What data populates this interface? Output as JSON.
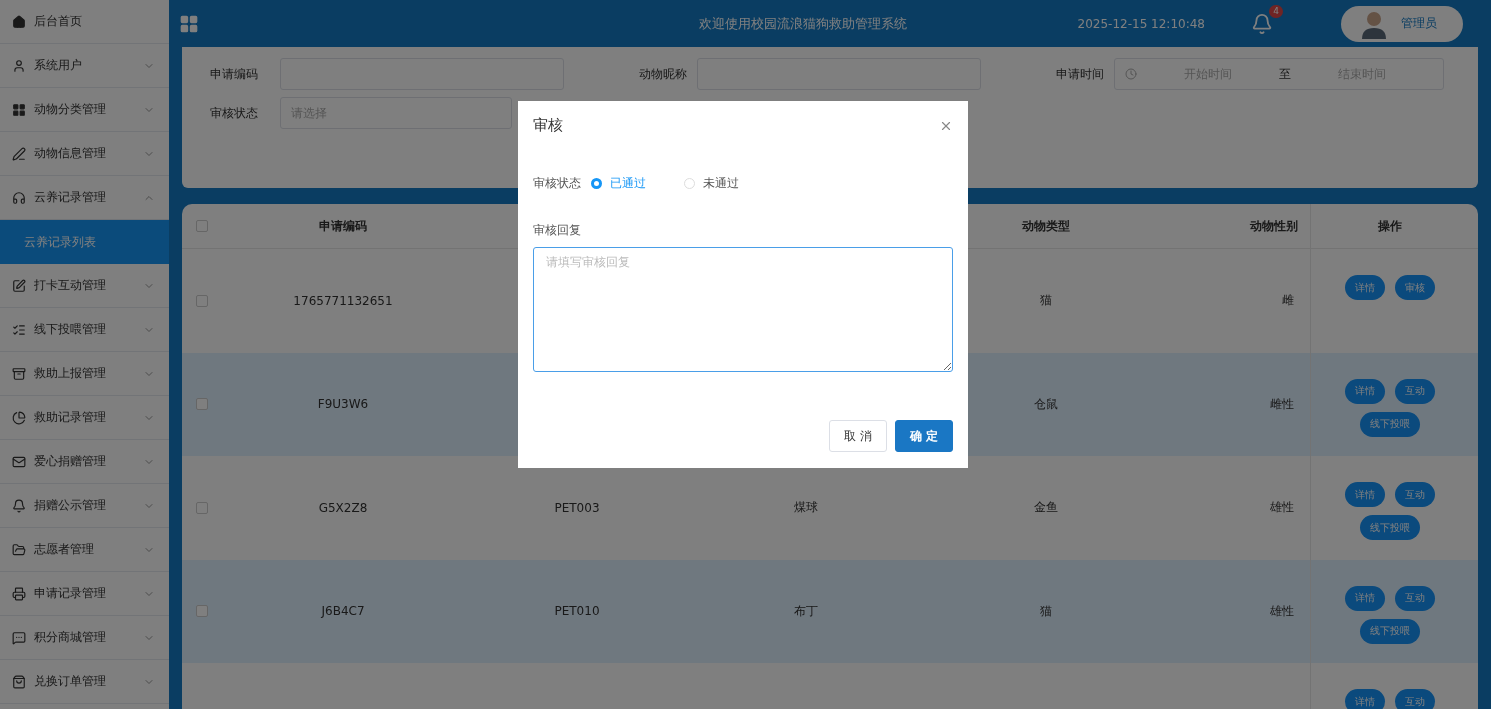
{
  "sidebar": {
    "items": [
      {
        "label": "后台首页",
        "selected": false
      },
      {
        "label": "系统用户",
        "selected": false,
        "expanded": false
      },
      {
        "label": "动物分类管理",
        "selected": false,
        "expanded": false
      },
      {
        "label": "动物信息管理",
        "selected": false,
        "expanded": false
      },
      {
        "label": "云养记录管理",
        "selected": false,
        "expanded": true,
        "children": [
          {
            "label": "云养记录列表",
            "selected": true
          }
        ]
      },
      {
        "label": "打卡互动管理",
        "selected": false,
        "expanded": false
      },
      {
        "label": "线下投喂管理",
        "selected": false,
        "expanded": false
      },
      {
        "label": "救助上报管理",
        "selected": false,
        "expanded": false
      },
      {
        "label": "救助记录管理",
        "selected": false,
        "expanded": false
      },
      {
        "label": "爱心捐赠管理",
        "selected": false,
        "expanded": false
      },
      {
        "label": "捐赠公示管理",
        "selected": false,
        "expanded": false
      },
      {
        "label": "志愿者管理",
        "selected": false,
        "expanded": false
      },
      {
        "label": "申请记录管理",
        "selected": false,
        "expanded": false
      },
      {
        "label": "积分商城管理",
        "selected": false,
        "expanded": false
      },
      {
        "label": "兑换订单管理",
        "selected": false,
        "expanded": false
      }
    ]
  },
  "header": {
    "title": "欢迎使用校园流浪猫狗救助管理系统",
    "datetime": "2025-12-15 12:10:48",
    "notification_count": "4",
    "user": "管理员"
  },
  "filters": {
    "code_label": "申请编码",
    "nickname_label": "动物昵称",
    "time_label": "申请时间",
    "time_start": "开始时间",
    "time_separator": "至",
    "time_end": "结束时间",
    "status_label": "审核状态",
    "status_placeholder": "请选择"
  },
  "table": {
    "all_checked": false,
    "columns": [
      "申请编码",
      null,
      null,
      "动物类型",
      "动物性别"
    ],
    "actions_header": "操作",
    "rows": [
      {
        "checked": false,
        "cells": [
          "1765771132651",
          null,
          null,
          "猫",
          "雌"
        ],
        "actions": [
          "详情",
          "审核"
        ]
      },
      {
        "checked": false,
        "cells": [
          "F9U3W6",
          null,
          null,
          "仓鼠",
          "雌性"
        ],
        "actions": [
          "详情",
          "互动",
          "线下投喂"
        ]
      },
      {
        "checked": false,
        "cells": [
          "G5X2Z8",
          "PET003",
          "煤球",
          "金鱼",
          "雄性"
        ],
        "actions": [
          "详情",
          "互动",
          "线下投喂"
        ]
      },
      {
        "checked": false,
        "cells": [
          "J6B4C7",
          "PET010",
          "布丁",
          "猫",
          "雄性"
        ],
        "actions": [
          "详情",
          "互动",
          "线下投喂"
        ]
      },
      {
        "cells": [
          null,
          null,
          null,
          null,
          null
        ],
        "actions": [
          "详情",
          "互动"
        ]
      }
    ]
  },
  "dialog": {
    "title": "审核",
    "status_label": "审核状态",
    "options": [
      {
        "label": "已通过",
        "selected": true
      },
      {
        "label": "未通过",
        "selected": false
      }
    ],
    "reply_label": "审核回复",
    "reply_placeholder": "请填写审核回复",
    "buttons": [
      "取 消",
      "确 定"
    ]
  }
}
